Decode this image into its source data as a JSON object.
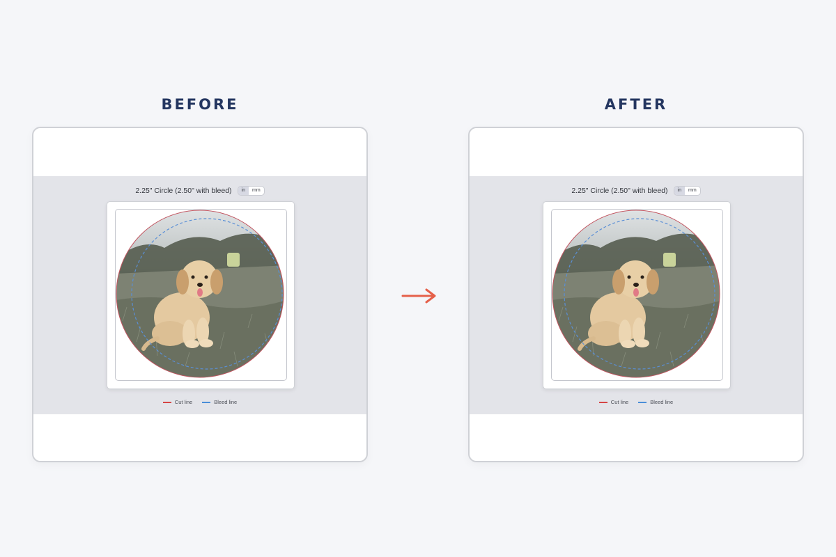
{
  "panels": {
    "before": {
      "title": "BEFORE",
      "size_label": "2.25\" Circle (2.50\" with bleed)",
      "units": [
        "in",
        "mm"
      ],
      "active_unit": "in",
      "legend": {
        "cut": "Cut line",
        "bleed": "Bleed line"
      }
    },
    "after": {
      "title": "AFTER",
      "size_label": "2.25\" Circle (2.50\" with bleed)",
      "units": [
        "in",
        "mm"
      ],
      "active_unit": "in",
      "legend": {
        "cut": "Cut line",
        "bleed": "Bleed line"
      }
    }
  },
  "image": {
    "subject": "puppy-photo"
  },
  "colors": {
    "title": "#243660",
    "arrow": "#e5604a",
    "cut_line": "#d64545",
    "bleed_line": "#4a8ed8",
    "band": "#e3e4e9"
  },
  "icons": {
    "arrow": "arrow-right-icon"
  }
}
